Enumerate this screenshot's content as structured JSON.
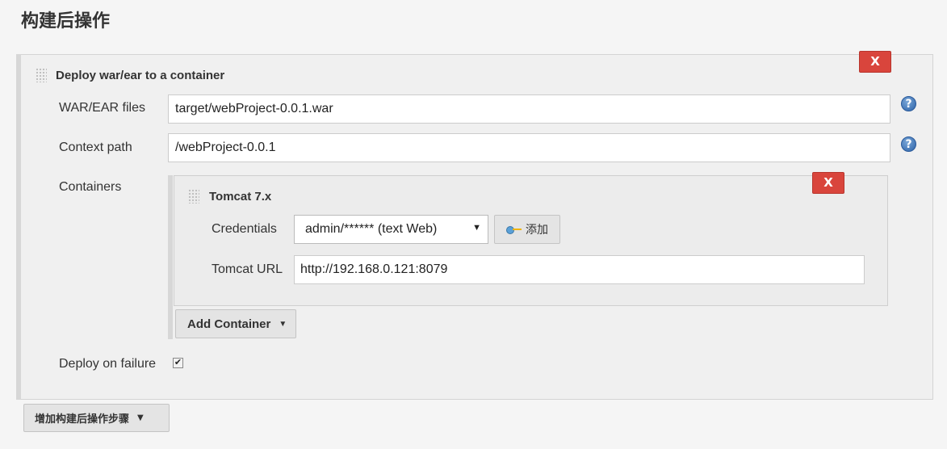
{
  "section": {
    "title": "构建后操作"
  },
  "step": {
    "title": "Deploy war/ear to a container",
    "delete_label": "X",
    "war_ear_files": {
      "label": "WAR/EAR files",
      "value": "target/webProject-0.0.1.war"
    },
    "context_path": {
      "label": "Context path",
      "value": "/webProject-0.0.1"
    },
    "containers_label": "Containers",
    "container": {
      "title": "Tomcat 7.x",
      "delete_label": "X",
      "credentials": {
        "label": "Credentials",
        "selected": "admin/****** (text Web)",
        "add_label": "添加"
      },
      "tomcat_url": {
        "label": "Tomcat URL",
        "value": "http://192.168.0.121:8079"
      }
    },
    "add_container_label": "Add Container",
    "deploy_on_failure": {
      "label": "Deploy on failure",
      "checked": true
    }
  },
  "add_step_label": "增加构建后操作步骤",
  "icons": {
    "help": "help-icon",
    "drag": "drag-handle-icon",
    "key": "key-icon",
    "dropdown": "caret-down-icon"
  },
  "colors": {
    "delete": "#d9453c",
    "help": "#2c62a8"
  }
}
